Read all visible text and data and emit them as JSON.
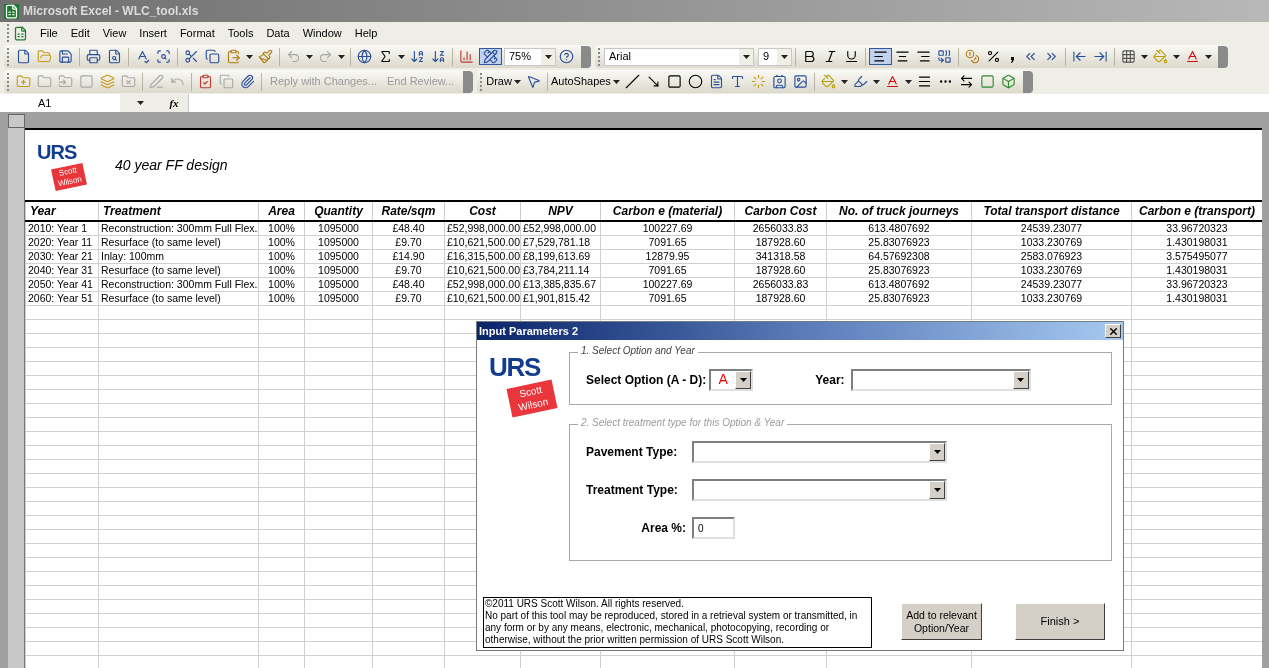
{
  "window": {
    "title": "Microsoft Excel - WLC_tool.xls"
  },
  "menu": [
    "File",
    "Edit",
    "View",
    "Insert",
    "Format",
    "Tools",
    "Data",
    "Window",
    "Help"
  ],
  "toolbar": {
    "zoom": "75%",
    "font": "Arial",
    "font_size": "9"
  },
  "reviewing_toolbar": [
    {
      "label": "Reply with Changes...",
      "disabled": true
    },
    {
      "label": "End Review...",
      "disabled": true
    }
  ],
  "drawing_toolbar": [
    "Draw",
    "AutoShapes"
  ],
  "formula_bar": {
    "name_box": "A1",
    "function_label": "fx"
  },
  "sheet": {
    "logo": {
      "main": "URS",
      "flag": [
        "Scott",
        "Wilson"
      ]
    },
    "title": "40 year FF design",
    "columns": [
      "Year",
      "Treatment",
      "Area",
      "Quantity",
      "Rate/sqm",
      "Cost",
      "NPV",
      "Carbon e (material)",
      "Carbon Cost",
      "No. of truck journeys",
      "Total transport distance",
      "Carbon e (transport)"
    ],
    "rows": [
      [
        "2010: Year 1",
        "Reconstruction: 300mm Full Flex.",
        "100%",
        "1095000",
        "£48.40",
        "£52,998,000.00",
        "£52,998,000.00",
        "100227.69",
        "2656033.83",
        "613.4807692",
        "24539.23077",
        "33.96720323"
      ],
      [
        "2020: Year 11",
        "Resurface (to same level)",
        "100%",
        "1095000",
        "£9.70",
        "£10,621,500.00",
        "£7,529,781.18",
        "7091.65",
        "187928.60",
        "25.83076923",
        "1033.230769",
        "1.430198031"
      ],
      [
        "2030: Year 21",
        "Inlay: 100mm",
        "100%",
        "1095000",
        "£14.90",
        "£16,315,500.00",
        "£8,199,613.69",
        "12879.95",
        "341318.58",
        "64.57692308",
        "2583.076923",
        "3.575495077"
      ],
      [
        "2040: Year 31",
        "Resurface (to same level)",
        "100%",
        "1095000",
        "£9.70",
        "£10,621,500.00",
        "£3,784,211.14",
        "7091.65",
        "187928.60",
        "25.83076923",
        "1033.230769",
        "1.430198031"
      ],
      [
        "2050: Year 41",
        "Reconstruction: 300mm Full Flex.",
        "100%",
        "1095000",
        "£48.40",
        "£52,998,000.00",
        "£13,385,835.67",
        "100227.69",
        "2656033.83",
        "613.4807692",
        "24539.23077",
        "33.96720323"
      ],
      [
        "2060: Year 51",
        "Resurface (to same level)",
        "100%",
        "1095000",
        "£9.70",
        "£10,621,500.00",
        "£1,901,815.42",
        "7091.65",
        "187928.60",
        "25.83076923",
        "1033.230769",
        "1.430198031"
      ]
    ]
  },
  "dialog": {
    "title": "Input Parameters 2",
    "logo": {
      "main": "URS",
      "flag": [
        "Scott",
        "Wilson"
      ]
    },
    "section_1": {
      "legend": "1. Select Option and Year",
      "disabled": false,
      "option_label": "Select Option (A - D):",
      "option_value": "A",
      "year_label": "Year:"
    },
    "section_2": {
      "legend": "2. Select treatment type for this Option & Year",
      "disabled": true,
      "pavement_label": "Pavement Type:",
      "treatment_label": "Treatment Type:",
      "area_label": "Area %:",
      "area_value": "0"
    },
    "copyright": [
      "©2011 URS Scott Wilson. All rights reserved.",
      "No part of this tool may be reproduced, stored in a retrieval system or transmitted, in any form or by any means, electronic, mechanical, photocopying, recording or otherwise, without the prior written permission of URS Scott Wilson."
    ],
    "buttons": [
      "Add to relevant Option/Year",
      "Finish >"
    ]
  }
}
